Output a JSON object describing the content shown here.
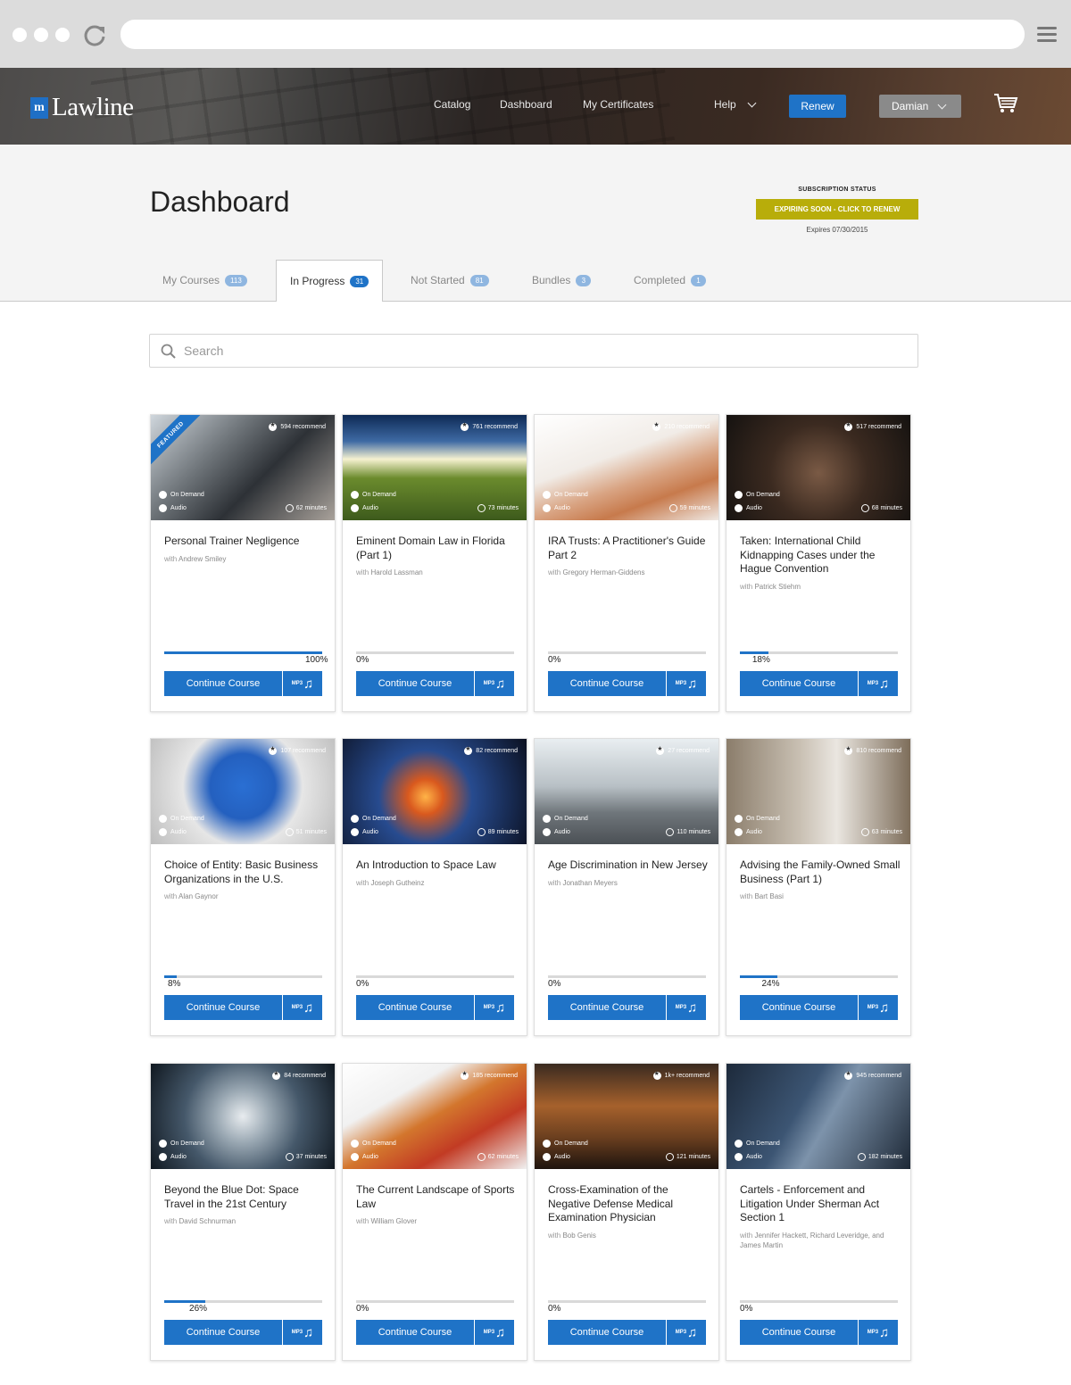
{
  "browser": {
    "reload_icon": "reload-icon",
    "menu_icon": "hamburger-menu-icon"
  },
  "header": {
    "logo_mark": "m",
    "logo_text": "Lawline",
    "nav": [
      "Catalog",
      "Dashboard",
      "My Certificates",
      "Help"
    ],
    "renew_label": "Renew",
    "user_label": "Damian",
    "cart_icon": "shopping-cart-icon"
  },
  "page": {
    "title": "Dashboard",
    "subscription": {
      "label": "SUBSCRIPTION STATUS",
      "button": "EXPIRING SOON - CLICK TO RENEW",
      "expires": "Expires 07/30/2015",
      "button_color": "#b8ad0a"
    }
  },
  "tabs": [
    {
      "label": "My Courses",
      "count": "113"
    },
    {
      "label": "In Progress",
      "count": "31"
    },
    {
      "label": "Not Started",
      "count": "81"
    },
    {
      "label": "Bundles",
      "count": "3"
    },
    {
      "label": "Completed",
      "count": "1"
    }
  ],
  "search": {
    "placeholder": "Search"
  },
  "card_labels": {
    "on_demand": "On Demand",
    "audio": "Audio",
    "continue": "Continue Course",
    "mp3": "MP3",
    "with": "with",
    "featured": "FEATURED"
  },
  "accent_color": "#1f73c7",
  "courses": [
    {
      "title": "Personal Trainer Negligence",
      "author": "Andrew Smiley",
      "recommend": "594 recommend",
      "minutes": "62 minutes",
      "progress": 100,
      "progress_label": "100%",
      "featured": true
    },
    {
      "title": "Eminent Domain Law in Florida (Part 1)",
      "author": "Harold Lassman",
      "recommend": "761 recommend",
      "minutes": "73 minutes",
      "progress": 0,
      "progress_label": "0%"
    },
    {
      "title": "IRA Trusts: A Practitioner's Guide Part 2",
      "author": "Gregory Herman-Giddens",
      "recommend": "210 recommend",
      "minutes": "59 minutes",
      "progress": 0,
      "progress_label": "0%"
    },
    {
      "title": "Taken: International Child Kidnapping Cases under the Hague Convention",
      "author": "Patrick Stiehm",
      "recommend": "517 recommend",
      "minutes": "68 minutes",
      "progress": 18,
      "progress_label": "18%"
    },
    {
      "title": "Choice of Entity: Basic Business Organizations in the U.S.",
      "author": "Alan Gaynor",
      "recommend": "107 recommend",
      "minutes": "51 minutes",
      "progress": 8,
      "progress_label": "8%"
    },
    {
      "title": "An Introduction to Space Law",
      "author": "Joseph Gutheinz",
      "recommend": "82 recommend",
      "minutes": "89 minutes",
      "progress": 0,
      "progress_label": "0%"
    },
    {
      "title": "Age Discrimination in New Jersey",
      "author": "Jonathan Meyers",
      "recommend": "27 recommend",
      "minutes": "110 minutes",
      "progress": 0,
      "progress_label": "0%"
    },
    {
      "title": "Advising the Family-Owned Small Business (Part 1)",
      "author": "Bart Basi",
      "recommend": "810 recommend",
      "minutes": "63 minutes",
      "progress": 24,
      "progress_label": "24%"
    },
    {
      "title": "Beyond the Blue Dot: Space Travel in the 21st Century",
      "author": "David Schnurman",
      "recommend": "84 recommend",
      "minutes": "37 minutes",
      "progress": 26,
      "progress_label": "26%"
    },
    {
      "title": "The Current Landscape of Sports Law",
      "author": "William Glover",
      "recommend": "185 recommend",
      "minutes": "62 minutes",
      "progress": 0,
      "progress_label": "0%"
    },
    {
      "title": "Cross-Examination of the Negative Defense Medical Examination Physician",
      "author": "Bob Genis",
      "recommend": "1k+ recommend",
      "minutes": "121 minutes",
      "progress": 0,
      "progress_label": "0%"
    },
    {
      "title": "Cartels - Enforcement and Litigation Under Sherman Act Section 1",
      "author": "Jennifer Hackett, Richard Leveridge, and James Martin",
      "recommend": "945 recommend",
      "minutes": "182 minutes",
      "progress": 0,
      "progress_label": "0%"
    }
  ]
}
